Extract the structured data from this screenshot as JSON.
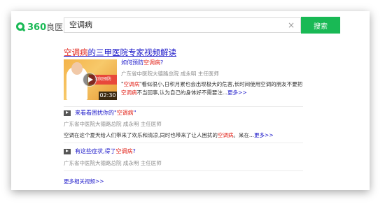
{
  "header": {
    "logo_text": "360",
    "logo_brand": "良医",
    "search_value": "空调病",
    "clear_glyph": "×",
    "search_button_label": "搜索"
  },
  "result": {
    "title_highlight": "空调病",
    "title_rest": "的三甲医院专家视频解读",
    "thumbnail": {
      "banner_text": "如何预防",
      "duration": "02:30"
    },
    "sub_title_prefix": "如何预防",
    "sub_title_highlight": "空调病",
    "sub_title_suffix": "?",
    "meta": "广东省中医院大德路总院    成永明    主任医师",
    "snippet_open_quote": "\"",
    "snippet_highlight1": "空调病",
    "snippet_part1": "\"看似很小,日积月累也会出现极大的危害,长时间使用空调的朋友不要把",
    "snippet_highlight2": "空调病",
    "snippet_part2": "不当回事,认为自己的身体好不需要注...",
    "snippet_more": "更多>>"
  },
  "items": [
    {
      "title_prefix": "来看看困扰你的\"",
      "title_highlight": "空调病",
      "title_suffix": "\"",
      "meta": "广东省中医院大德路总院    成永明    主任医师",
      "snippet_prefix": "空调在这个夏天给人们带来了欢乐和清凉,同时也带来了让人困扰的",
      "snippet_highlight": "空调病",
      "snippet_suffix": "。呆在...",
      "more": "更多>>"
    },
    {
      "title_prefix": "有这些症状,得了",
      "title_highlight": "空调病",
      "title_suffix": "?",
      "meta": "广东省中医院大德路总院    成永明    主任医师"
    }
  ],
  "footer_link": "更多相关视频>>",
  "colors": {
    "accent_green": "#19b955",
    "link_blue": "#1b17c9",
    "highlight_red": "#e2231a"
  }
}
